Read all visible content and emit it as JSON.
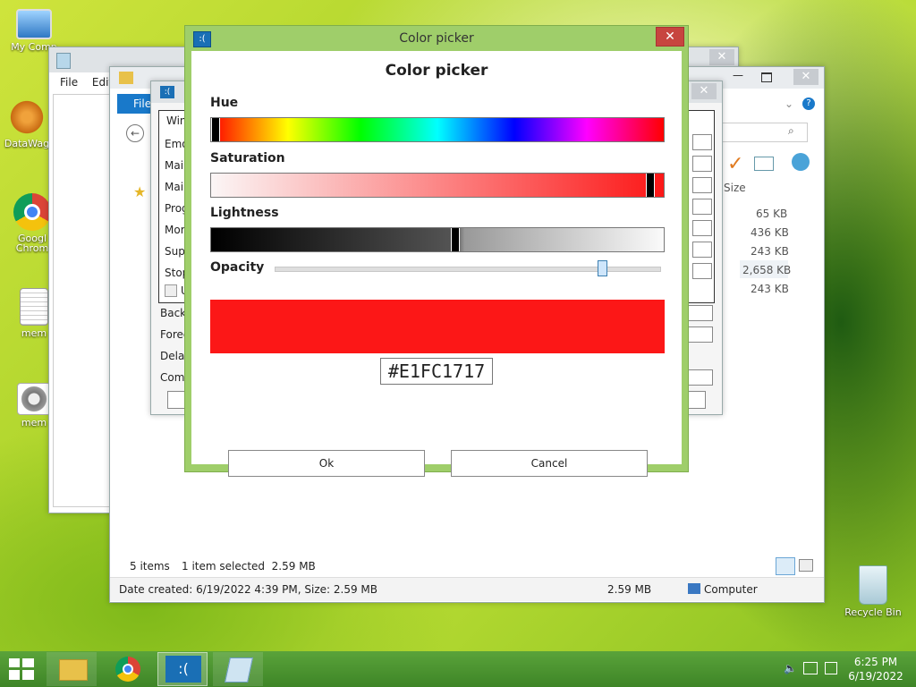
{
  "desktop": {
    "icons": [
      {
        "label": "My Comp",
        "icon": "computer-icon"
      },
      {
        "label": "DataWag",
        "icon": "app-shortcut-icon"
      },
      {
        "label": "Googl",
        "icon": "chrome-icon"
      },
      {
        "label": "Chrom",
        "icon": "chrome-icon"
      },
      {
        "label": "mem",
        "icon": "text-file-icon"
      },
      {
        "label": "mem",
        "icon": "settings-file-icon"
      },
      {
        "label": "Recycle Bin",
        "icon": "recycle-bin-icon"
      }
    ]
  },
  "notepad": {
    "menu": [
      "File",
      "Edit"
    ]
  },
  "explorer": {
    "ribbon_file_tab": "File",
    "column_size": "Size",
    "sizes": [
      "65 KB",
      "436 KB",
      "243 KB",
      "2,658 KB",
      "243 KB"
    ],
    "status_items": "5 items",
    "status_selected": "1 item selected  2.59 MB",
    "details_text": "Date created: 6/19/2022 4:39 PM, Size: 2.59 MB",
    "details_size": "2.59 MB",
    "details_location": "Computer"
  },
  "settings_window": {
    "group_label": "Wind",
    "items": [
      "Emo",
      "Main",
      "Main",
      "Prog",
      "More",
      "Supp",
      "Stop"
    ],
    "checkbox_label": "U",
    "rows": [
      "Back",
      "Foreg",
      "Delay",
      "Comr"
    ]
  },
  "color_picker": {
    "window_title": "Color picker",
    "heading": "Color picker",
    "hue_label": "Hue",
    "saturation_label": "Saturation",
    "lightness_label": "Lightness",
    "opacity_label": "Opacity",
    "hue_value": 0,
    "saturation_value": 0.98,
    "lightness_value": 0.54,
    "opacity_value": 0.86,
    "preview_color": "#FC1717",
    "hex_value": "#E1FC1717",
    "ok_label": "Ok",
    "cancel_label": "Cancel"
  },
  "taskbar": {
    "time": "6:25 PM",
    "date": "6/19/2022"
  },
  "colors": {
    "dialog_frame": "#9fce6a",
    "accent_close": "#c7453f",
    "taskbar": "#4a932f"
  }
}
